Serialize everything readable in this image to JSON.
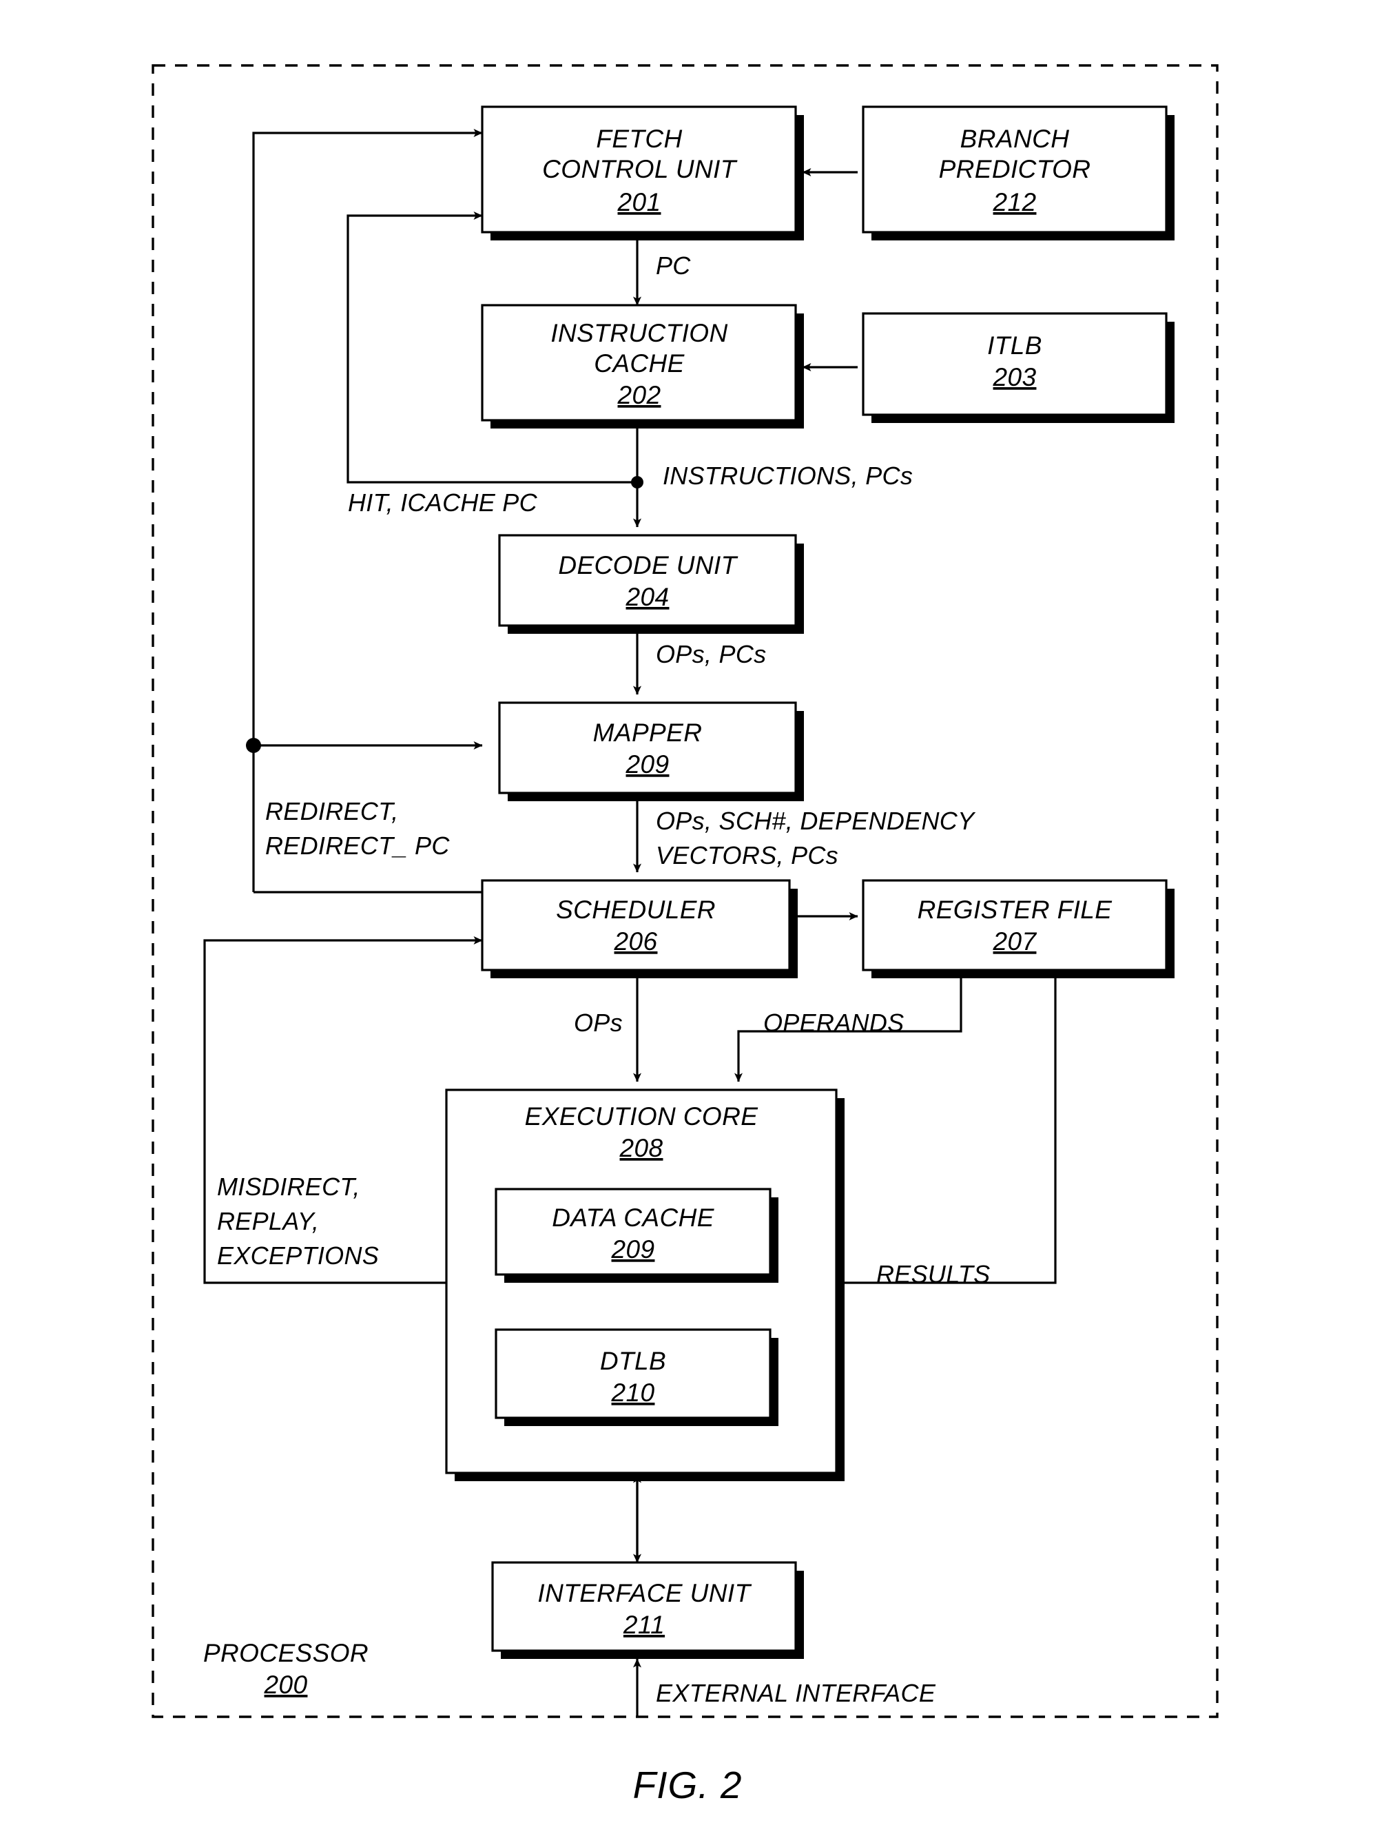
{
  "figure": {
    "caption": "FIG. 2",
    "container_label": "PROCESSOR",
    "container_number": "200"
  },
  "blocks": [
    {
      "id": "fetch_control_unit",
      "line1": "FETCH",
      "line2": "CONTROL UNIT",
      "number": "201"
    },
    {
      "id": "branch_predictor",
      "line1": "BRANCH",
      "line2": "PREDICTOR",
      "number": "212"
    },
    {
      "id": "instruction_cache",
      "line1": "INSTRUCTION",
      "line2": "CACHE",
      "number": "202"
    },
    {
      "id": "itlb",
      "line1": "ITLB",
      "line2": "",
      "number": "203"
    },
    {
      "id": "decode_unit",
      "line1": "DECODE UNIT",
      "line2": "",
      "number": "204"
    },
    {
      "id": "mapper",
      "line1": "MAPPER",
      "line2": "",
      "number": "209"
    },
    {
      "id": "scheduler",
      "line1": "SCHEDULER",
      "line2": "",
      "number": "206"
    },
    {
      "id": "register_file",
      "line1": "REGISTER FILE",
      "line2": "",
      "number": "207"
    },
    {
      "id": "execution_core",
      "line1": "EXECUTION CORE",
      "line2": "",
      "number": "208"
    },
    {
      "id": "data_cache",
      "line1": "DATA CACHE",
      "line2": "",
      "number": "209"
    },
    {
      "id": "dtlb",
      "line1": "DTLB",
      "line2": "",
      "number": "210"
    },
    {
      "id": "interface_unit",
      "line1": "INTERFACE UNIT",
      "line2": "",
      "number": "211"
    }
  ],
  "signals": {
    "pc": "PC",
    "instructions_pcs": "INSTRUCTIONS, PCs",
    "hit_icache_pc": "HIT, ICACHE PC",
    "ops_pcs": "OPs, PCs",
    "redirect_line1": "REDIRECT,",
    "redirect_line2": "REDIRECT_ PC",
    "mapper_out_line1": "OPs, SCH#, DEPENDENCY",
    "mapper_out_line2": "VECTORS, PCs",
    "ops": "OPs",
    "operands": "OPERANDS",
    "results": "RESULTS",
    "misdirect_line1": "MISDIRECT,",
    "misdirect_line2": "REPLAY,",
    "misdirect_line3": "EXCEPTIONS",
    "external_interface": "EXTERNAL INTERFACE"
  },
  "colors": {
    "ink": "#000000",
    "paper": "#ffffff"
  }
}
